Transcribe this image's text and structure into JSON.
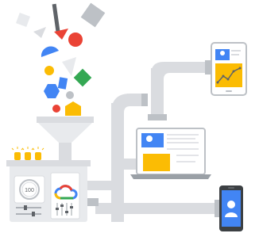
{
  "illustration": {
    "gauge_reading": "100",
    "cloud_logo": "google-cloud-logo",
    "colors": {
      "blue": "#4285F4",
      "red": "#EA4335",
      "yellow": "#FBBC04",
      "green": "#34A853",
      "gray_pipe": "#DADCE0",
      "gray_dark": "#5F6368",
      "gray_light": "#F1F3F4"
    },
    "devices": [
      "tablet",
      "laptop",
      "phone"
    ],
    "icons": [
      "funnel-icon",
      "machine-icon",
      "pipe-icon",
      "line-chart-icon",
      "person-icon"
    ]
  }
}
